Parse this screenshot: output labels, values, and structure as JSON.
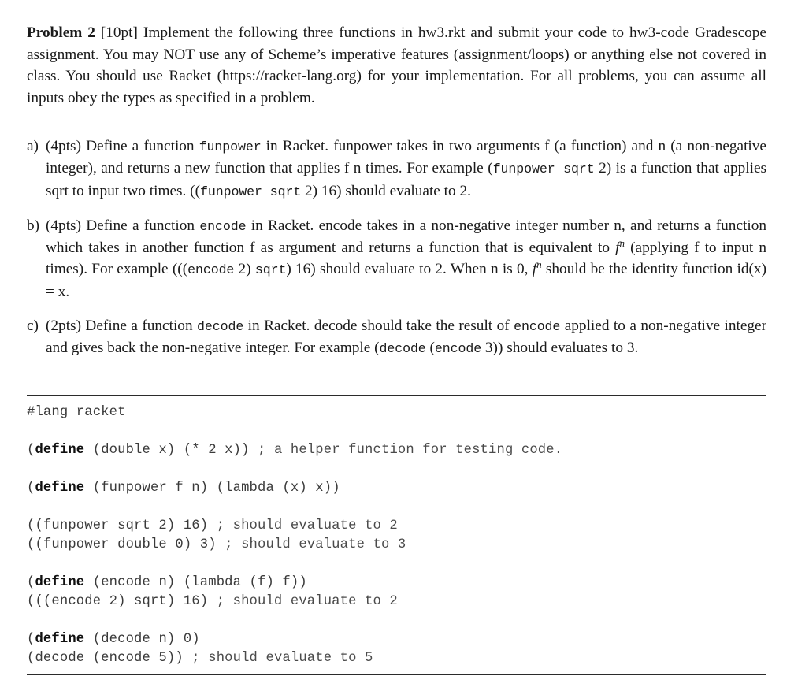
{
  "document": {
    "problem_label": "Problem 2",
    "points_label": "[10pt]",
    "intro_text": " Implement the following three functions in hw3.rkt and submit your code to hw3-code Gradescope assignment.  You may NOT use any of Scheme’s imperative features (assignment/loops) or anything else not covered in class. You should use Racket (https://racket-lang.org) for your implementation. For all problems, you can assume all inputs obey the types as specified in a problem."
  },
  "parts": {
    "a": {
      "marker": "a)",
      "points": "(4pts)",
      "t1": " Define a function ",
      "code1": "funpower",
      "t2": " in Racket.  funpower takes in two arguments f (a function) and n (a non-negative integer), and returns a new function that applies f n times. For example (",
      "code2": "funpower sqrt",
      "t3": " 2) is a function that applies sqrt to input two times. ((",
      "code3": "funpower sqrt",
      "t4": " 2) 16) should evaluate to 2."
    },
    "b": {
      "marker": "b)",
      "points": "(4pts)",
      "t1": " Define a function ",
      "code1": "encode",
      "t2": " in Racket. encode takes in a non-negative integer number n, and returns a function which takes in another function f as argument and returns a function that is equivalent to ",
      "math1_base": "f",
      "math1_sup": "n",
      "t3": " (applying f to input n times). For example (((",
      "code2": "encode",
      "t4": " 2) ",
      "code3": "sqrt",
      "t5": ") 16) should evaluate to 2. When n is 0, ",
      "math2_base": "f",
      "math2_sup": "n",
      "t6": " should be the identity function id(x) = x."
    },
    "c": {
      "marker": "c)",
      "points": "(2pts)",
      "t1": " Define a function ",
      "code1": "decode",
      "t2": " in Racket. decode should take the result of ",
      "code2": "encode",
      "t3": " applied to a non-negative integer and gives back the non-negative integer.  For example (",
      "code3": "decode",
      "t4": " (",
      "code4": "encode",
      "t5": " 3)) should evaluates to 3."
    }
  },
  "code_listing": {
    "lines": [
      {
        "segments": [
          {
            "text": "#lang racket",
            "style": "plain"
          }
        ]
      },
      {
        "segments": []
      },
      {
        "segments": [
          {
            "text": "(",
            "style": "plain"
          },
          {
            "text": "define",
            "style": "keyword"
          },
          {
            "text": " (double x) (* 2 x)) ",
            "style": "plain"
          },
          {
            "text": "; a helper function for testing code.",
            "style": "comment"
          }
        ]
      },
      {
        "segments": []
      },
      {
        "segments": [
          {
            "text": "(",
            "style": "plain"
          },
          {
            "text": "define",
            "style": "keyword"
          },
          {
            "text": " (funpower f n) (lambda (x) x))",
            "style": "plain"
          }
        ]
      },
      {
        "segments": []
      },
      {
        "segments": [
          {
            "text": "((funpower sqrt 2) 16) ",
            "style": "plain"
          },
          {
            "text": "; should evaluate to 2",
            "style": "comment"
          }
        ]
      },
      {
        "segments": [
          {
            "text": "((funpower double 0) 3) ",
            "style": "plain"
          },
          {
            "text": "; should evaluate to 3",
            "style": "comment"
          }
        ]
      },
      {
        "segments": []
      },
      {
        "segments": [
          {
            "text": "(",
            "style": "plain"
          },
          {
            "text": "define",
            "style": "keyword"
          },
          {
            "text": " (encode n) (lambda (f) f))",
            "style": "plain"
          }
        ]
      },
      {
        "segments": [
          {
            "text": "(((encode 2) sqrt) 16) ",
            "style": "plain"
          },
          {
            "text": "; should evaluate to 2",
            "style": "comment"
          }
        ]
      },
      {
        "segments": []
      },
      {
        "segments": [
          {
            "text": "(",
            "style": "plain"
          },
          {
            "text": "define",
            "style": "keyword"
          },
          {
            "text": " (decode n) 0)",
            "style": "plain"
          }
        ]
      },
      {
        "segments": [
          {
            "text": "(decode (encode 5)) ",
            "style": "plain"
          },
          {
            "text": "; should evaluate to 5",
            "style": "comment"
          }
        ]
      }
    ]
  },
  "colors": {
    "page_background": "#ffffff",
    "body_text": "#1a1a1a",
    "code_text": "#3a3a3a",
    "rule": "#2b2b2b"
  }
}
